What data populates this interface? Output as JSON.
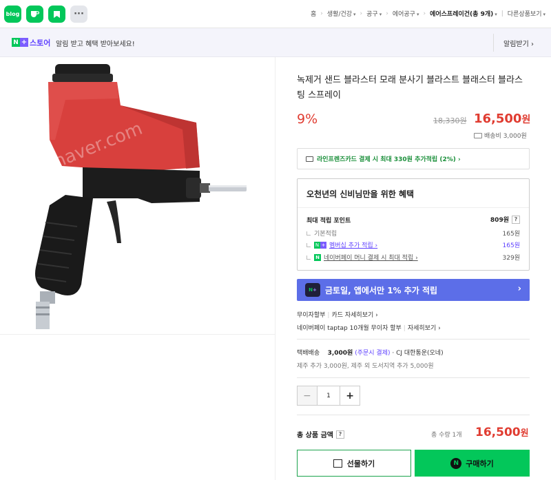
{
  "topbar": {
    "apps": [
      {
        "name": "blog",
        "label": "blog"
      },
      {
        "name": "cafe",
        "label": ""
      },
      {
        "name": "post",
        "label": ""
      },
      {
        "name": "more",
        "label": "···"
      }
    ],
    "breadcrumb": [
      {
        "label": "홈",
        "dropdown": false
      },
      {
        "label": "생활/건강",
        "dropdown": true
      },
      {
        "label": "공구",
        "dropdown": true
      },
      {
        "label": "에어공구",
        "dropdown": true
      },
      {
        "label": "에어스프레이건(총 9개)",
        "dropdown": true
      },
      {
        "label": "다른상품보기",
        "dropdown": true
      }
    ]
  },
  "banner": {
    "badge_n": "N",
    "badge_plus": "+",
    "store_label": "스토어",
    "message": "알림 받고 혜택 받아보세요!",
    "alarm_button": "알림받기 ›"
  },
  "product": {
    "title": "녹제거 샌드 블라스터 모래 분사기 블라스트 블래스터 블라스팅 스프레이",
    "discount": "9%",
    "original_price": "18,330원",
    "price_num": "16,500",
    "price_unit": "원",
    "shipping_fee": "배송비 3,000원"
  },
  "card_offer": "라인프렌즈카드 결제 시 최대 330원 추가적립 (2%) ›",
  "benefit": {
    "title": "오천년의 신비님만을 위한 혜택",
    "max_points_label": "최대 적립 포인트",
    "max_points_value": "809원",
    "help": "?",
    "rows": [
      {
        "label": "기본적립",
        "value": "165원"
      },
      {
        "label": "멤버십 추가 적립 ›",
        "value": "165원"
      },
      {
        "label": "네이버페이 머니 결제 시 최대 적립 ›",
        "value": "329원"
      }
    ]
  },
  "promo": {
    "label": "금토일, 앱에서만 1% 추가 적립",
    "arrow": "›"
  },
  "installment": {
    "label": "무이자할부",
    "card_link": "카드 자세히보기 ›",
    "line2": "네이버페이 taptap 10개월 무이자 할부",
    "line2_link": "자세히보기 ›"
  },
  "shipping": {
    "type": "택배배송",
    "fee": "3,000원",
    "condition": "(주문시 결제)",
    "carrier": "· CJ 대한통운(오네)",
    "extra": "제주 추가 3,000원, 제주 외 도서지역 추가 5,000원"
  },
  "quantity": {
    "minus": "−",
    "value": "1",
    "plus": "+"
  },
  "total": {
    "label": "총 상품 금액",
    "help": "?",
    "qty": "총 수량 1개",
    "price_num": "16,500",
    "price_unit": "원"
  },
  "buttons": {
    "gift": "선물하기",
    "buy": "구매하기",
    "buy_icon": "N"
  },
  "image": {
    "watermark": "e.naver.com"
  },
  "colors": {
    "naver_green": "#03c75a",
    "plus_purple": "#7b5cff",
    "price_red": "#e03c31",
    "promo_blue": "#5c6ee8"
  }
}
